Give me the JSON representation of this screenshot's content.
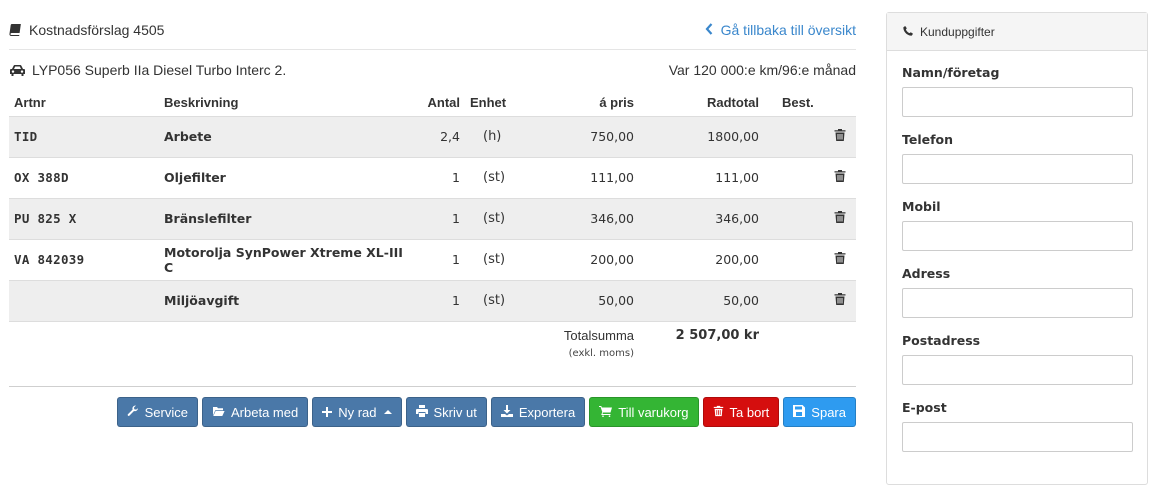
{
  "header": {
    "title": "Kostnadsförslag 4505",
    "back_link": "Gå tillbaka till översikt",
    "vehicle": "LYP056 Superb IIa Diesel Turbo Interc 2.",
    "service_interval": "Var 120 000:e km/96:e månad"
  },
  "table": {
    "columns": [
      "Artnr",
      "Beskrivning",
      "Antal",
      "Enhet",
      "á pris",
      "Radtotal",
      "Best."
    ],
    "rows": [
      {
        "artnr": "TID",
        "desc": "Arbete",
        "qty": "2,4",
        "unit": "(h)",
        "price": "750,00",
        "total": "1800,00"
      },
      {
        "artnr": "OX 388D",
        "desc": "Oljefilter",
        "qty": "1",
        "unit": "(st)",
        "price": "111,00",
        "total": "111,00"
      },
      {
        "artnr": "PU 825 X",
        "desc": "Bränslefilter",
        "qty": "1",
        "unit": "(st)",
        "price": "346,00",
        "total": "346,00"
      },
      {
        "artnr": "VA 842039",
        "desc": "Motorolja SynPower Xtreme XL-III C",
        "qty": "1",
        "unit": "(st)",
        "price": "200,00",
        "total": "200,00"
      },
      {
        "artnr": "",
        "desc": "Miljöavgift",
        "qty": "1",
        "unit": "(st)",
        "price": "50,00",
        "total": "50,00"
      }
    ],
    "total_label": "Totalsumma",
    "total_sublabel": "(exkl. moms)",
    "total_value": "2 507,00 kr"
  },
  "toolbar": {
    "service": "Service",
    "work_with": "Arbeta med",
    "new_row": "Ny rad",
    "print": "Skriv ut",
    "export": "Exportera",
    "to_cart": "Till varukorg",
    "delete": "Ta bort",
    "save": "Spara"
  },
  "customer_panel": {
    "title": "Kunduppgifter",
    "fields": [
      {
        "label": "Namn/företag",
        "value": ""
      },
      {
        "label": "Telefon",
        "value": ""
      },
      {
        "label": "Mobil",
        "value": ""
      },
      {
        "label": "Adress",
        "value": ""
      },
      {
        "label": "Postadress",
        "value": ""
      },
      {
        "label": "E-post",
        "value": ""
      }
    ]
  },
  "colors": {
    "link": "#3a87cc",
    "button_primary": "#4a78a8",
    "button_success": "#34b534",
    "button_danger": "#d50e0e",
    "button_save": "#2e9bf0",
    "row_stripe": "#eeeeee"
  },
  "icons": [
    "book-icon",
    "chevron-left-icon",
    "car-icon",
    "trash-icon",
    "wrench-icon",
    "folder-open-icon",
    "plus-icon",
    "print-icon",
    "download-icon",
    "cart-icon",
    "save-icon",
    "phone-icon"
  ]
}
